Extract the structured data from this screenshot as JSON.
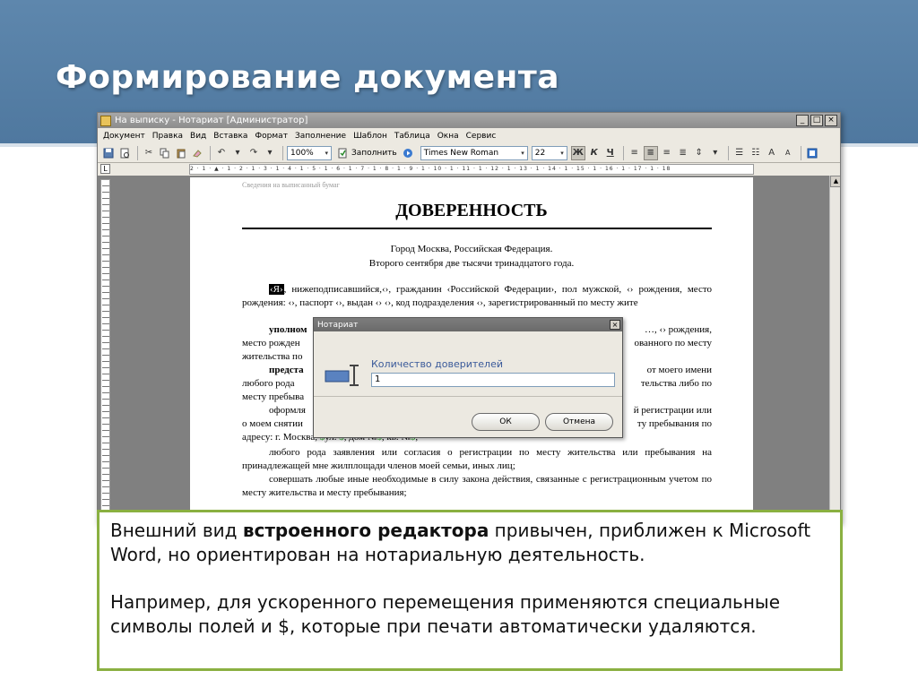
{
  "slide": {
    "title": "Формирование документа"
  },
  "window": {
    "title": "На выписку - Нотариат [Администратор]",
    "min_btn": "_",
    "max_btn": "□",
    "close_btn": "×"
  },
  "menu": {
    "items": [
      "Документ",
      "Правка",
      "Вид",
      "Вставка",
      "Формат",
      "Заполнение",
      "Шаблон",
      "Таблица",
      "Окна",
      "Сервис"
    ]
  },
  "toolbar": {
    "zoom": "100%",
    "fill_label": "Заполнить",
    "font_name": "Times New Roman",
    "font_size": "22",
    "bold": "Ж",
    "italic": "К",
    "underline": "Ч"
  },
  "ruler": {
    "corner": "L",
    "marks": "2 · 1 · ▲ · 1 · 2 · 1 · 3 · 1 · 4 · 1 · 5 · 1 · 6 · 1 · 7 · 1 · 8 · 1 · 9 · 1 · 10 · 1 · 11 · 1 · 12 · 1 · 13 · 1 · 14 · 1 · 15 · 1 · 16 · 1 · 17 · 1 · 18"
  },
  "document": {
    "hint": "Сведения на выписанный бумаг",
    "title": "ДОВЕРЕННОСТЬ",
    "city_line": "Город Москва, Российская Федерация.",
    "date_line": "Второго сентября две тысячи тринадцатого года.",
    "p1_marker": "‹Я›",
    "p1_rest": ", нижеподписавшийся,‹›, гражданин ‹Российской Федерации›, пол мужской, ‹› рождения, место рождения: ‹›, паспорт ‹›, выдан ‹› ‹›, код подразделения ‹›, зарегистрированный по месту жите",
    "p2_a": "уполном",
    "p2_b": "…, ‹› рождения,",
    "p2_c": "место рожден",
    "p2_d": "ованного по месту",
    "p2_e": "жительства по",
    "p3_a": "предста",
    "p3_b": "от моего имени",
    "p3_c": "любого рода",
    "p3_d": "тельства либо по",
    "p3_e": "месту пребыва",
    "p4_a": "оформля",
    "p4_b": "й регистрации или",
    "p4_c": "о моем снятии",
    "p4_d": "ту пребывания по",
    "address_prefix": "адресу: г. Москва,",
    "address_f1": "$",
    "address_t1": "ул.",
    "address_f2": "$",
    "address_t2": ", дом №",
    "address_f3": "$",
    "address_t3": ", кв. №",
    "address_f4": "$",
    "address_end": ",",
    "p5": "любого рода заявления или согласия о регистрации по месту жительства или пребывания на принадлежащей мне жилплощади членов моей семьи, иных лиц;",
    "p6": "совершать любые иные необходимые в силу закона действия, связанные с регистрационным учетом по месту жительства и месту пребывания;"
  },
  "dialog": {
    "title": "Нотариат",
    "close": "×",
    "label": "Количество доверителей",
    "value": "1",
    "ok": "ОК",
    "cancel": "Отмена"
  },
  "caption": {
    "p1_before": "Внешний вид ",
    "p1_bold": "встроенного редактора",
    "p1_after": " привычен, приближен к Microsoft Word, но ориентирован на нотариальную деятельность.",
    "p2": "Например, для ускоренного перемещения применяются специальные символы полей и $, которые при печати автоматически удаляются."
  },
  "colors": {
    "header_band": "#5e87ad",
    "caption_border": "#8ab041",
    "field_marker": "#2fa82f",
    "dialog_label": "#3a5a9a"
  }
}
